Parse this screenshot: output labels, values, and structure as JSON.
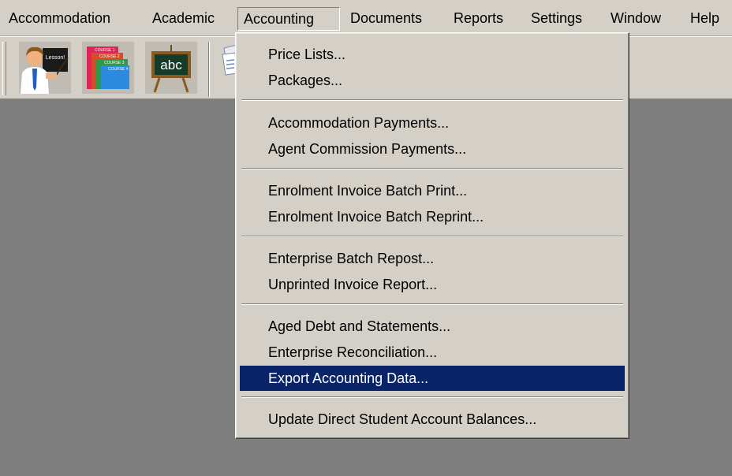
{
  "menubar": {
    "items": [
      {
        "label": "Accommodation"
      },
      {
        "label": "Academic"
      },
      {
        "label": "Accounting"
      },
      {
        "label": "Documents"
      },
      {
        "label": "Reports"
      },
      {
        "label": "Settings"
      },
      {
        "label": "Window"
      },
      {
        "label": "Help"
      }
    ],
    "active": "Accounting"
  },
  "toolbar": {
    "buttons": [
      {
        "icon": "teacher-lesson-icon",
        "text": "Lesson!"
      },
      {
        "icon": "course-books-icon",
        "text": [
          "COURSE 1",
          "COURSE 2",
          "COURSE 3",
          "COURSE 4"
        ]
      },
      {
        "icon": "chalkboard-abc-icon",
        "text": "abc"
      },
      {
        "icon": "documents-icon"
      }
    ]
  },
  "dropdown": {
    "items": [
      {
        "label": "Price Lists..."
      },
      {
        "label": "Packages..."
      },
      {
        "label": "Accommodation Payments..."
      },
      {
        "label": "Agent Commission Payments..."
      },
      {
        "label": "Enrolment Invoice Batch Print..."
      },
      {
        "label": "Enrolment Invoice Batch Reprint..."
      },
      {
        "label": "Enterprise Batch Repost..."
      },
      {
        "label": "Unprinted Invoice Report..."
      },
      {
        "label": "Aged Debt and Statements..."
      },
      {
        "label": "Enterprise Reconciliation..."
      },
      {
        "label": "Export Accounting Data..."
      },
      {
        "label": "Update Direct Student Account Balances..."
      }
    ],
    "highlighted": "Export Accounting Data..."
  },
  "colors": {
    "face": "#d4d0c8",
    "workspace": "#7f7f7f",
    "highlight": "#0a246a",
    "highlight_text": "#ffffff"
  }
}
